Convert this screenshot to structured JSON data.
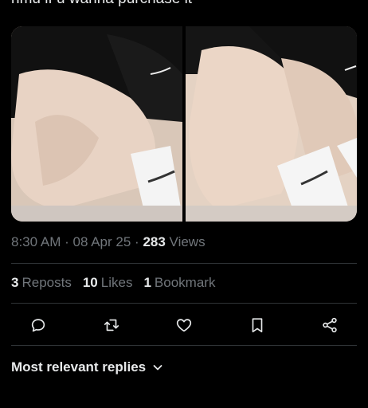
{
  "tweet": {
    "text": "hmu if u wanna purchase it"
  },
  "media": {
    "left_photo_icon": "image-thumbnail",
    "right_photo_icon": "image-thumbnail"
  },
  "meta": {
    "time": "8:30 AM",
    "sep1": "·",
    "date": "08 Apr 25",
    "sep2": "·",
    "views_count": "283",
    "views_label": "Views"
  },
  "stats": {
    "reposts_count": "3",
    "reposts_label": "Reposts",
    "likes_count": "10",
    "likes_label": "Likes",
    "bookmarks_count": "1",
    "bookmarks_label": "Bookmark"
  },
  "actions": {
    "reply_icon": "reply-icon",
    "repost_icon": "repost-icon",
    "like_icon": "heart-icon",
    "bookmark_icon": "bookmark-icon",
    "share_icon": "share-icon"
  },
  "replies": {
    "sort_label": "Most relevant replies"
  },
  "colors": {
    "background": "#000000",
    "text": "#e7e9ea",
    "muted": "#71767b",
    "divider": "#2f3336"
  }
}
